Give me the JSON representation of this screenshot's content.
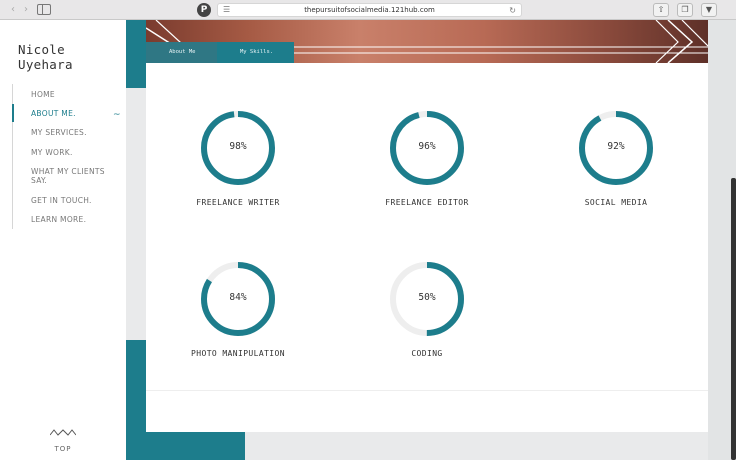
{
  "browser": {
    "url": "thepursuitofsocialmedia.121hub.com",
    "pinterest_label": "P"
  },
  "site": {
    "logo": "Nicole Uyehara",
    "menu": [
      {
        "label": "HOME",
        "active": false
      },
      {
        "label": "ABOUT ME.",
        "active": true
      },
      {
        "label": "MY SERVICES.",
        "active": false
      },
      {
        "label": "MY WORK.",
        "active": false
      },
      {
        "label": "WHAT MY CLIENTS SAY.",
        "active": false
      },
      {
        "label": "GET IN TOUCH.",
        "active": false
      },
      {
        "label": "LEARN MORE.",
        "active": false
      }
    ],
    "active_indicator": "~",
    "top_label": "TOP"
  },
  "tabs": [
    {
      "label": "About Me",
      "active": false
    },
    {
      "label": "My Skills.",
      "active": true
    }
  ],
  "skills": [
    {
      "name": "FREELANCE WRITER",
      "percent": 98,
      "percent_label": "98%"
    },
    {
      "name": "FREELANCE EDITOR",
      "percent": 96,
      "percent_label": "96%"
    },
    {
      "name": "SOCIAL MEDIA",
      "percent": 92,
      "percent_label": "92%"
    },
    {
      "name": "PHOTO MANIPULATION",
      "percent": 84,
      "percent_label": "84%"
    },
    {
      "name": "CODING",
      "percent": 50,
      "percent_label": "50%"
    }
  ],
  "colors": {
    "accent": "#1d7d8c",
    "ring_track": "#eeeeee"
  }
}
